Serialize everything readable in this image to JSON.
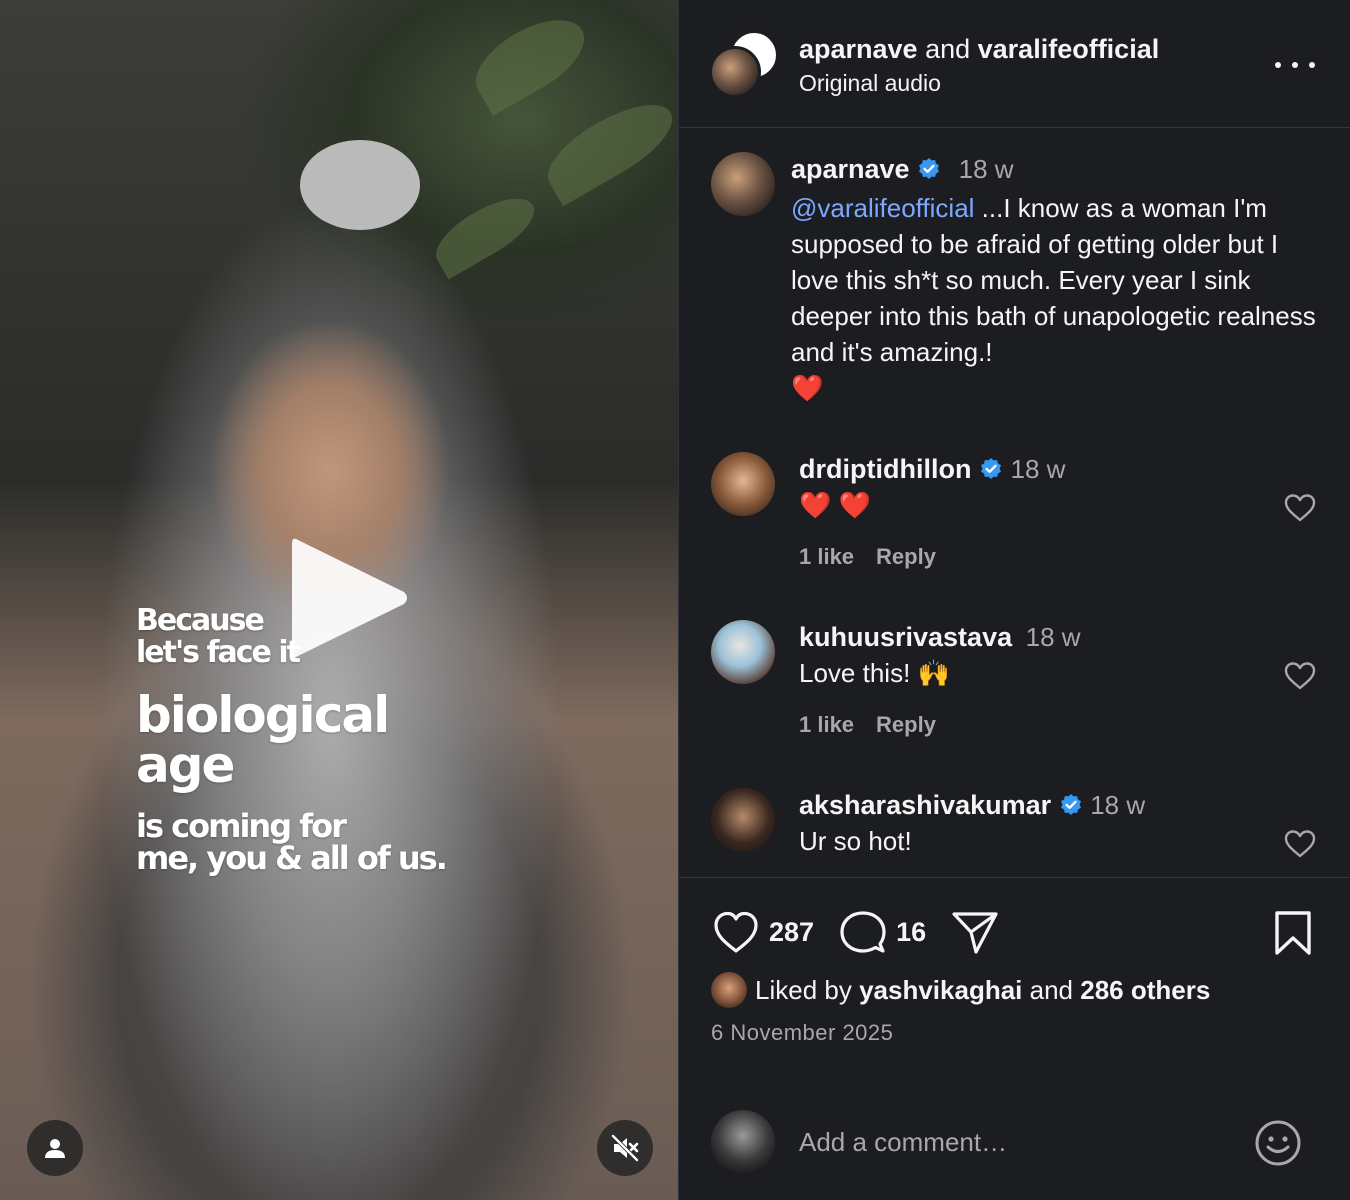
{
  "video": {
    "overlay_lines": [
      "Because",
      "let's face it",
      "biological",
      "age",
      "is coming for",
      "me, you & all of us."
    ]
  },
  "header": {
    "user1": "aparnave",
    "joiner": " and ",
    "user2": "varalifeofficial",
    "audio": "Original audio"
  },
  "caption": {
    "username": "aparnave",
    "time": "18 w",
    "mention": "@varalifeofficial",
    "text": " ...I know as a woman I'm supposed to be afraid of getting older but I love this sh*t so much. Every year I sink deeper into this bath of unapologetic realness and it's amazing.!",
    "emoji": "❤️"
  },
  "comments": [
    {
      "username": "drdiptidhillon",
      "time": "18 w",
      "text": "❤️ ❤️",
      "likes": "1 like",
      "reply": "Reply"
    },
    {
      "username": "kuhuusrivastava",
      "time": "18 w",
      "text": "Love this! 🙌",
      "likes": "1 like",
      "reply": "Reply"
    },
    {
      "username": "aksharashivakumar",
      "time": "18 w",
      "text": "Ur so hot!"
    }
  ],
  "actions": {
    "like_count": "287",
    "comment_count": "16"
  },
  "liked_by": {
    "prefix": "Liked by ",
    "user": "yashvikaghai",
    "joiner": " and ",
    "others": "286 others"
  },
  "date": "6 November 2025",
  "composer": {
    "placeholder": "Add a comment…"
  },
  "colors": {
    "panel_bg": "#1c1d21",
    "mention": "#7da8ff",
    "verified": "#3897f0",
    "muted_text": "#a8a8a8"
  },
  "icons": [
    "play-icon",
    "user-icon",
    "mute-icon",
    "more-icon",
    "verified-icon",
    "heart-icon",
    "comment-icon",
    "share-icon",
    "bookmark-icon",
    "emoji-icon"
  ]
}
